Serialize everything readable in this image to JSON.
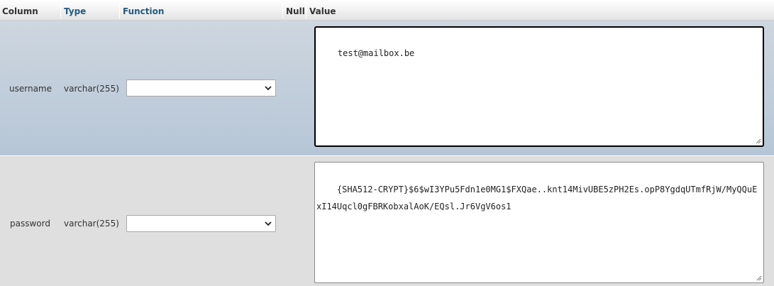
{
  "headers": {
    "column": "Column",
    "type": "Type",
    "function": "Function",
    "null": "Null",
    "value": "Value"
  },
  "rows": [
    {
      "column": "username",
      "type": "varchar(255)",
      "function": "",
      "value": "test@mailbox.be"
    },
    {
      "column": "password",
      "type": "varchar(255)",
      "function": "",
      "value": "{SHA512-CRYPT}$6$wI3YPu5Fdn1e0MG1$FXQae..knt14MivUBE5zPH2Es.opP8YgdqUTmfRjW/MyQQuExI14Uqcl0gFBRKobxalAoK/EQsl.Jr6VgV6os1"
    }
  ],
  "icons": {
    "select_arrow": "chevron-down-icon",
    "resize_handle": "resize-grip-icon"
  },
  "colors": {
    "header_link": "#235a81",
    "row_highlight": "#c4d0dd",
    "row_even": "#dfdfdf"
  }
}
